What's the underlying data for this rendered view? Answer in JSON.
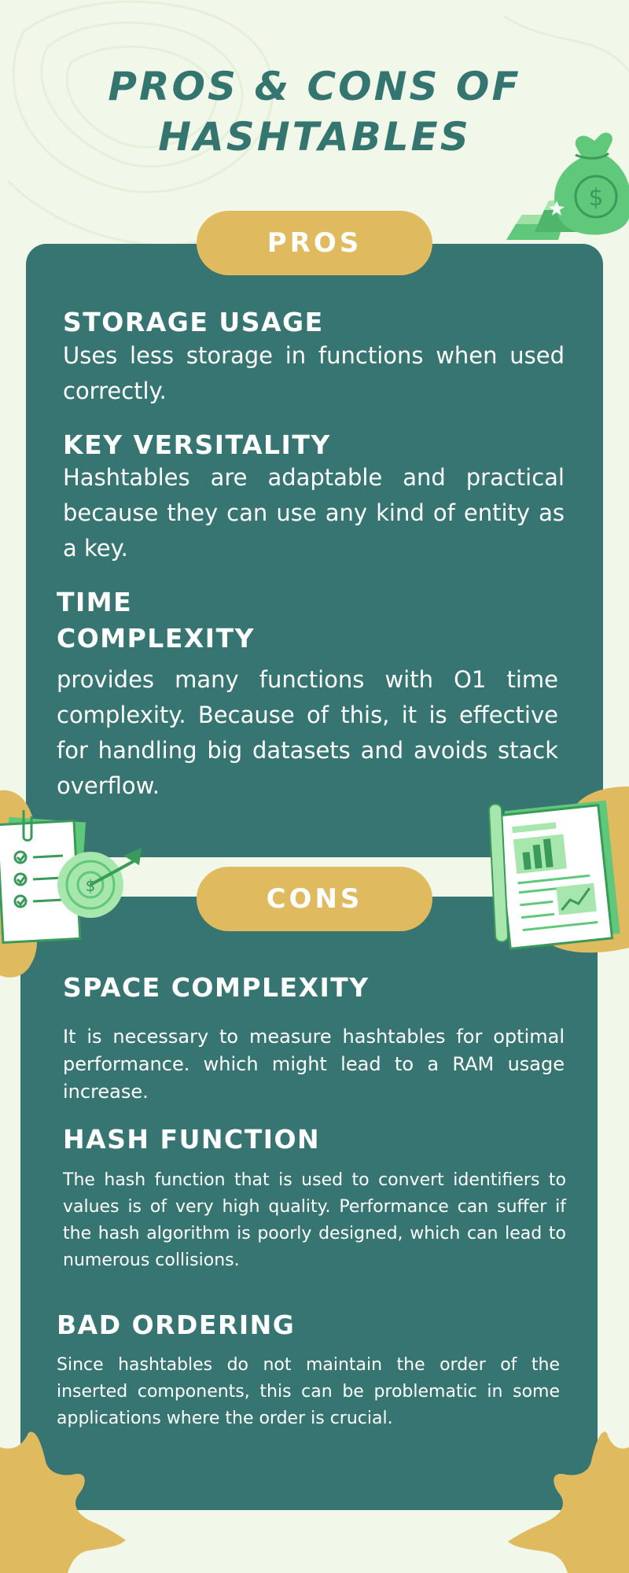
{
  "title": {
    "line1": "PROS & CONS OF",
    "line2": "HASHTABLES"
  },
  "pros": {
    "label": "PROS",
    "items": [
      {
        "heading": "STORAGE USAGE",
        "body": "Uses less storage in functions when used correctly."
      },
      {
        "heading": "KEY VERSITALITY",
        "body": "Hashtables are adaptable and practical because they can use any kind of entity as a key."
      },
      {
        "heading_line1": "TIME",
        "heading_line2": "COMPLEXITY",
        "body": "provides many functions with O1 time complexity. Because of this, it is effective for handling big datasets and avoids stack overflow."
      }
    ]
  },
  "cons": {
    "label": "CONS",
    "items": [
      {
        "heading": "SPACE COMPLEXITY",
        "body": "It is necessary to measure hashtables for optimal performance. which might lead to a RAM usage increase."
      },
      {
        "heading": "HASH FUNCTION",
        "body": "The hash function that is used to convert identifiers to values is of very high quality. Performance can suffer if the hash algorithm is poorly designed, which can lead to numerous collisions."
      },
      {
        "heading": "BAD ORDERING",
        "body": "Since hashtables do not maintain the order of the inserted components, this can be problematic in some applications where the order is crucial."
      }
    ]
  },
  "colors": {
    "background": "#f1f8ea",
    "panel": "#367572",
    "accent": "#dfba5e",
    "title": "#347570",
    "illustration_green": "#5fc87a"
  },
  "icons": [
    "contour-lines",
    "money-bag-icon",
    "checklist-icon",
    "target-dollar-icon",
    "report-document-icon",
    "star-shape"
  ]
}
